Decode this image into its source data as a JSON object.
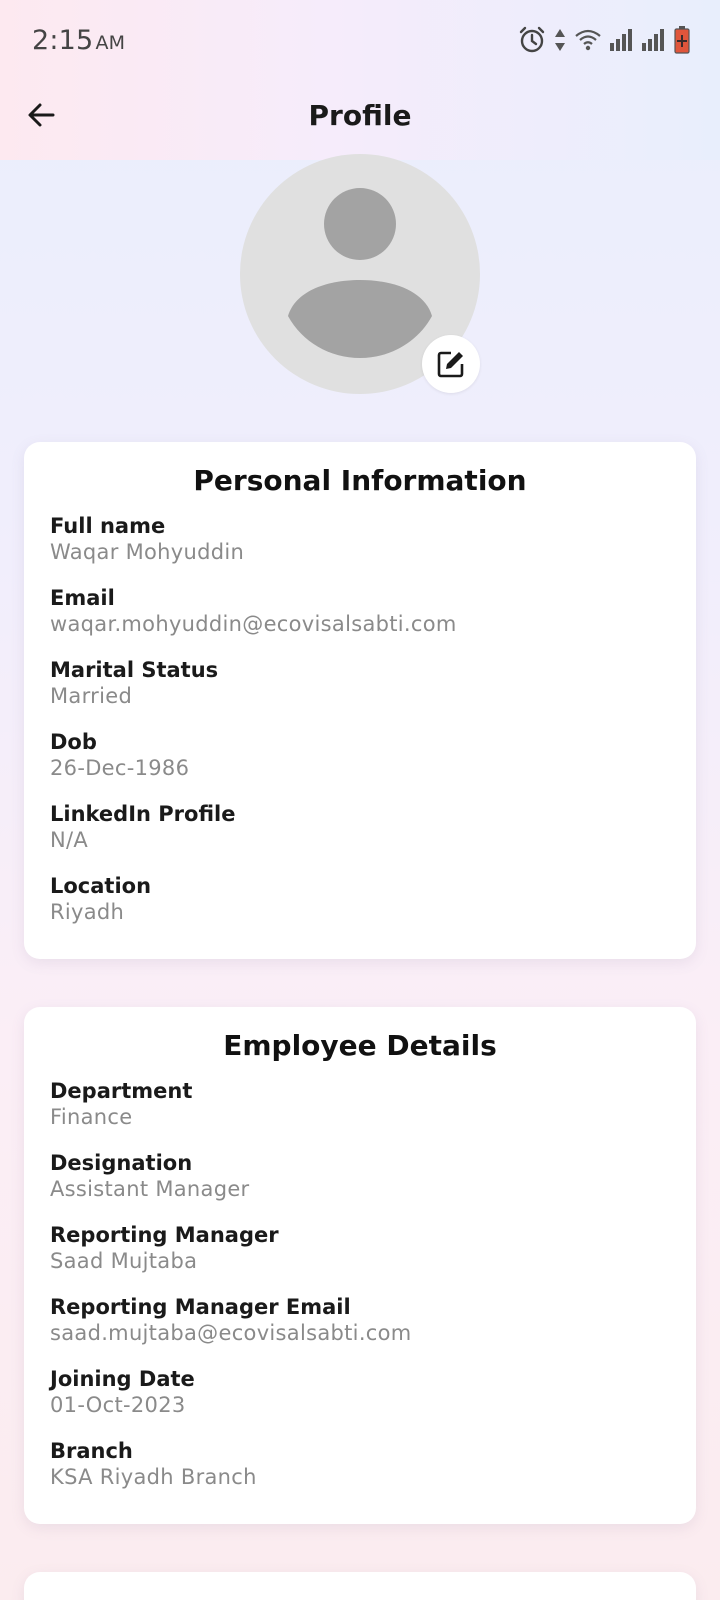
{
  "status_bar": {
    "time": "2:15",
    "ampm": "AM",
    "icons": [
      "alarm-icon",
      "data-arrows-icon",
      "wifi-icon",
      "signal-icon",
      "signal-icon",
      "battery-icon"
    ],
    "battery_color": "#e0553b"
  },
  "app_bar": {
    "title": "Profile",
    "back_icon": "arrow-left-icon"
  },
  "avatar": {
    "placeholder_icon": "person-icon",
    "edit_icon": "edit-icon"
  },
  "personal": {
    "title": "Personal Information",
    "fields": [
      {
        "label": "Full name",
        "value": "Waqar Mohyuddin"
      },
      {
        "label": "Email",
        "value": "waqar.mohyuddin@ecovisalsabti.com"
      },
      {
        "label": "Marital Status",
        "value": "Married"
      },
      {
        "label": "Dob",
        "value": "26-Dec-1986"
      },
      {
        "label": "LinkedIn Profile",
        "value": "N/A"
      },
      {
        "label": "Location",
        "value": "Riyadh"
      }
    ]
  },
  "employee": {
    "title": "Employee Details",
    "fields": [
      {
        "label": "Department",
        "value": "Finance"
      },
      {
        "label": "Designation",
        "value": "Assistant Manager"
      },
      {
        "label": "Reporting Manager",
        "value": "Saad Mujtaba"
      },
      {
        "label": "Reporting Manager Email",
        "value": "saad.mujtaba@ecovisalsabti.com"
      },
      {
        "label": "Joining Date",
        "value": "01-Oct-2023"
      },
      {
        "label": "Branch",
        "value": "KSA Riyadh Branch"
      }
    ]
  },
  "colors": {
    "label": "#1a1a1a",
    "value": "#8a8a8a",
    "avatar_bg": "#e0e0e0",
    "avatar_fg": "#a3a3a3"
  }
}
